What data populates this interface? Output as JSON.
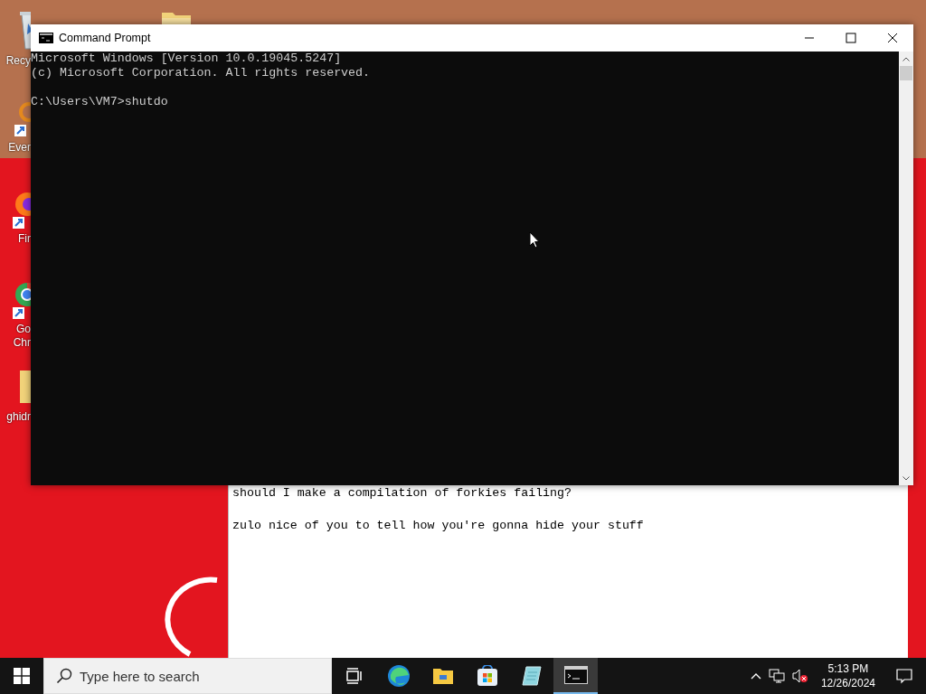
{
  "desktop": {
    "icons": [
      {
        "kind": "bin",
        "label_lines": [
          "Recy"
        ]
      },
      {
        "kind": "folder"
      },
      {
        "kind": "search-app",
        "label_lines": [
          "Ever"
        ]
      },
      {
        "kind": "fox",
        "label_lines": [
          "Fir"
        ]
      },
      {
        "kind": "chrome",
        "label_lines": [
          "Go",
          "Chr"
        ]
      },
      {
        "kind": "yellow-app",
        "label_lines": [
          "ghidr"
        ]
      }
    ]
  },
  "notepad": {
    "paragraphs": [
      [
        "should I make a compilation of forkies failing?"
      ],
      [
        "zulo nice of you to tell how you're gonna hide your stuff"
      ]
    ]
  },
  "command_prompt": {
    "title": "Command Prompt",
    "output": [
      "Microsoft Windows [Version 10.0.19045.5247]",
      "(c) Microsoft Corporation. All rights reserved."
    ],
    "prompt": "C:\\Users\\VM7>shutdo"
  },
  "taskbar": {
    "search": {
      "placeholder": "Type here to search"
    },
    "apps": [
      {
        "kind": "task-view",
        "active": false
      },
      {
        "kind": "edge",
        "active": false
      },
      {
        "kind": "explorer",
        "active": false
      },
      {
        "kind": "store",
        "active": false
      },
      {
        "kind": "notepad",
        "active": false
      },
      {
        "kind": "terminal",
        "active": true
      }
    ],
    "time": "5:13 PM",
    "date": "12/26/2024"
  }
}
